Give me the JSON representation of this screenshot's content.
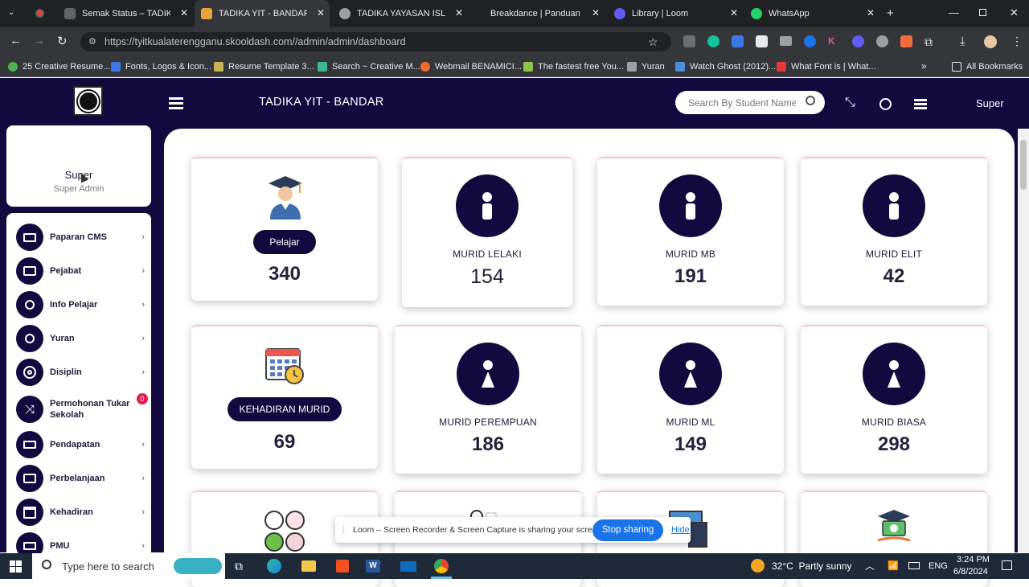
{
  "browser": {
    "tabs": [
      {
        "label": "Semak Status – TADIKA Y",
        "active": false
      },
      {
        "label": "TADIKA YIT - BANDAR",
        "active": true
      },
      {
        "label": "TADIKA YAYASAN ISLAM",
        "active": false
      },
      {
        "label": "Breakdance | Panduan Gu",
        "active": false
      },
      {
        "label": "Library | Loom",
        "active": false
      },
      {
        "label": "WhatsApp",
        "active": false
      }
    ],
    "url": "https://tyitkualaterengganu.skooldash.com//admin/admin/dashboard",
    "bookmarks": [
      "25 Creative Resume...",
      "Fonts, Logos & Icon...",
      "Resume Template 3...",
      "Search ~ Creative M...",
      "Webmail BENAMICI...",
      "The fastest free You...",
      "Yuran",
      "Watch Ghost (2012)...",
      "What Font is | What..."
    ],
    "all_bookmarks": "All Bookmarks"
  },
  "header": {
    "title": "TADIKA YIT - BANDAR",
    "search_placeholder": "Search By Student Name",
    "user": "Super"
  },
  "profile": {
    "name": "Super",
    "role": "Super Admin"
  },
  "sidebar": {
    "items": [
      {
        "label": "Paparan CMS",
        "icon": "monitor-icon"
      },
      {
        "label": "Pejabat",
        "icon": "briefcase-icon"
      },
      {
        "label": "Info Pelajar",
        "icon": "student-icon"
      },
      {
        "label": "Yuran",
        "icon": "money-hand-icon"
      },
      {
        "label": "Disiplin",
        "icon": "target-icon"
      },
      {
        "label": "Permohonan Tukar Sekolah",
        "icon": "shuffle-icon",
        "badge": "0"
      },
      {
        "label": "Pendapatan",
        "icon": "cash-stack-icon"
      },
      {
        "label": "Perbelanjaan",
        "icon": "wallet-icon"
      },
      {
        "label": "Kehadiran",
        "icon": "calendar-icon"
      },
      {
        "label": "PMU",
        "icon": "book-icon"
      }
    ]
  },
  "stats": {
    "pelajar": {
      "label": "Pelajar",
      "value": "340"
    },
    "murid_lelaki": {
      "label": "MURID LELAKI",
      "value": "154"
    },
    "murid_mb": {
      "label": "MURID MB",
      "value": "191"
    },
    "murid_elit": {
      "label": "MURID ELIT",
      "value": "42"
    },
    "kehadiran": {
      "label": "KEHADIRAN MURID",
      "value": "69"
    },
    "murid_perempuan": {
      "label": "MURID PEREMPUAN",
      "value": "186"
    },
    "murid_ml": {
      "label": "MURID ML",
      "value": "149"
    },
    "murid_biasa": {
      "label": "MURID BIASA",
      "value": "298"
    }
  },
  "loom": {
    "message": "Loom – Screen Recorder & Screen Capture is sharing your screen.",
    "stop": "Stop sharing",
    "hide": "Hide"
  },
  "taskbar": {
    "search_placeholder": "Type here to search",
    "weather": "32°C  Partly sunny",
    "lang": "ENG",
    "time": "3:24 PM",
    "date": "6/8/2024"
  },
  "colors": {
    "navy": "#120a3e",
    "accent_pink": "#f2c6d8"
  }
}
